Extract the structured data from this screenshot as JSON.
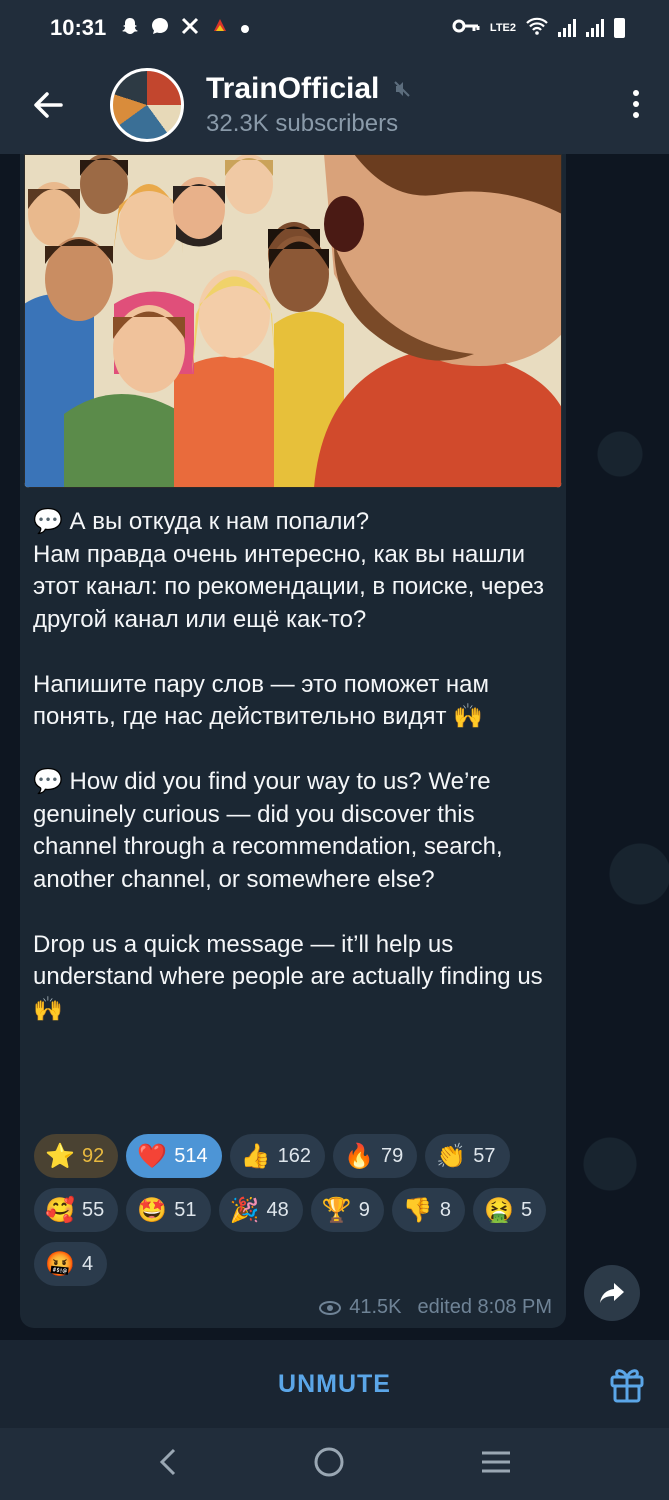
{
  "status_bar": {
    "time": "10:31",
    "network_label": "LTE2",
    "icons": [
      "snapchat-icon",
      "messenger-icon",
      "x-icon",
      "app-icon",
      "dot-icon",
      "key-icon",
      "wifi-icon",
      "signal-icon",
      "signal-icon",
      "battery-icon"
    ]
  },
  "header": {
    "title": "TrainOfficial",
    "subtitle": "32.3K subscribers",
    "muted": true
  },
  "message": {
    "paragraphs": [
      "💬 А вы откуда к нам попали?\nНам правда очень интересно, как вы нашли этот канал: по рекомендации, в поиске, через другой канал или ещё как-то?",
      "Напишите пару слов — это поможет нам понять, где нас действительно видят 🙌",
      "💬 How did you find your way to us? We’re genuinely curious — did you discover this channel through a recommendation, search, another channel, or somewhere else?",
      "Drop us a quick message — it’ll help us understand where people are actually finding us 🙌"
    ],
    "reactions": [
      {
        "emoji": "⭐",
        "count": "92",
        "kind": "star"
      },
      {
        "emoji": "❤️",
        "count": "514",
        "kind": "heart"
      },
      {
        "emoji": "👍",
        "count": "162",
        "kind": "normal"
      },
      {
        "emoji": "🔥",
        "count": "79",
        "kind": "normal"
      },
      {
        "emoji": "👏",
        "count": "57",
        "kind": "normal"
      },
      {
        "emoji": "🥰",
        "count": "55",
        "kind": "normal"
      },
      {
        "emoji": "🤩",
        "count": "51",
        "kind": "normal"
      },
      {
        "emoji": "🎉",
        "count": "48",
        "kind": "normal"
      },
      {
        "emoji": "🏆",
        "count": "9",
        "kind": "normal"
      },
      {
        "emoji": "👎",
        "count": "8",
        "kind": "normal"
      },
      {
        "emoji": "🤮",
        "count": "5",
        "kind": "normal"
      },
      {
        "emoji": "🤬",
        "count": "4",
        "kind": "normal"
      }
    ],
    "views": "41.5K",
    "edited": "edited 8:08 PM"
  },
  "bottom_bar": {
    "unmute_label": "UNMUTE"
  },
  "colors": {
    "accent": "#5ba6e8",
    "bubble": "#1b2733",
    "header": "#212d3b",
    "heart_chip": "#4d95d6"
  }
}
